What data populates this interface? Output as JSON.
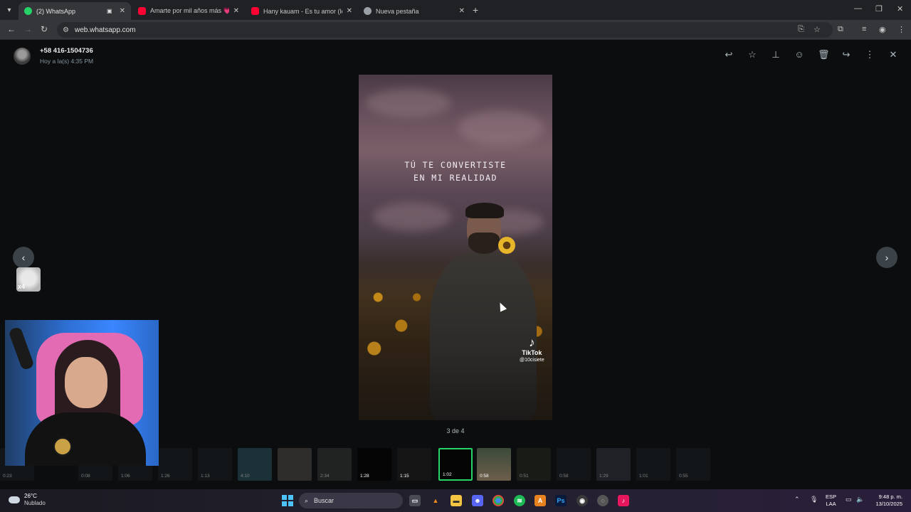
{
  "browser": {
    "tabs": [
      {
        "title": "(2) WhatsApp",
        "favicon_color": "#25d366"
      },
      {
        "title": "Amarte por mil años más 💗 (e",
        "favicon_color": "#ff0033"
      },
      {
        "title": "Hany kauam - Es tu amor (letra",
        "favicon_color": "#ff0033"
      },
      {
        "title": "Nueva pestaña",
        "favicon_color": "#9aa0a6"
      }
    ],
    "url": "web.whatsapp.com"
  },
  "viewer": {
    "contact_name": "+58 416-1504736",
    "timestamp": "Hoy a la(s) 4:35 PM",
    "actions": [
      "reply-icon",
      "star-icon",
      "pin-icon",
      "emoji-icon",
      "delete-icon",
      "forward-icon",
      "more-icon",
      "close-icon"
    ],
    "media": {
      "quote_line1": "TÚ TE CONVERTISTE",
      "quote_line2": "EN MI REALIDAD",
      "watermark": "TikTok",
      "watermark_handle": "@10cisiete"
    },
    "counter": "3 de 4",
    "sticker_label": "x4",
    "thumbnails": [
      {
        "dur": "0:23"
      },
      {
        "dur": "0:08"
      },
      {
        "dur": "1:06"
      },
      {
        "dur": "1:26"
      },
      {
        "dur": "1:13"
      },
      {
        "dur": "4:10"
      },
      {
        "dur": ""
      },
      {
        "dur": "2:34"
      },
      {
        "dur": "1:28"
      },
      {
        "dur": "1:15"
      },
      {
        "dur": "1:02"
      },
      {
        "dur": "0:58"
      },
      {
        "dur": "0:51"
      },
      {
        "dur": "0:58"
      },
      {
        "dur": "1:29"
      },
      {
        "dur": "1:01"
      },
      {
        "dur": "0:55"
      }
    ]
  },
  "taskbar": {
    "temp": "26°C",
    "condition": "Nublado",
    "search_placeholder": "Buscar",
    "lang_line1": "ESP",
    "lang_line2": "LAA",
    "time": "9:48 p. m.",
    "date": "13/10/2025"
  }
}
